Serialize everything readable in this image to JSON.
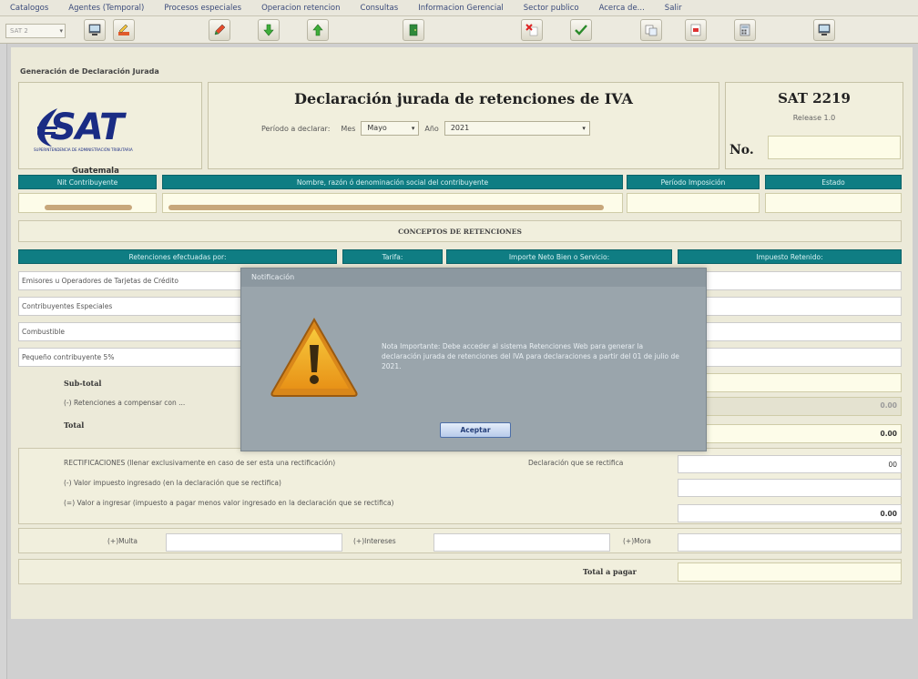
{
  "menu": [
    "Catalogos",
    "Agentes (Temporal)",
    "Procesos especiales",
    "Operacion retencion",
    "Consultas",
    "Informacion Gerencial",
    "Sector publico",
    "Acerca de...",
    "Salir"
  ],
  "toolbar": {
    "combo_value": "SAT 2",
    "icons": [
      "monitor-icon",
      "signature-icon",
      "pen-icon",
      "arrow-down-icon",
      "arrow-up-icon",
      "exit-door-icon",
      "cancel-x-icon",
      "check-icon",
      "copy-icon",
      "pdf-icon",
      "calculator-icon",
      "monitor-icon"
    ]
  },
  "section_title": "Generación de Declaración Jurada",
  "logo": {
    "text": "SAT",
    "subtitle": "SUPERINTENDENCIA DE ADMINISTRACIÓN TRIBUTARIA",
    "country": "Guatemala",
    "brand_color": "#1a2c84"
  },
  "declaration": {
    "title": "Declaración jurada de retenciones de IVA",
    "period_label": "Período a declarar:",
    "month_label": "Mes",
    "month_value": "Mayo",
    "year_label": "Año",
    "year_value": "2021"
  },
  "form_code": {
    "code": "SAT 2219",
    "release": "Release 1.0",
    "number_label": "No.",
    "number_value": ""
  },
  "taxpayer_headers": [
    "Nit Contribuyente",
    "Nombre, razón ó denominación social del contribuyente",
    "Período Imposición",
    "Estado"
  ],
  "concepts_title": "CONCEPTOS DE RETENCIONES",
  "retention_headers": [
    "Retenciones efectuadas por:",
    "Tarifa:",
    "Importe Neto Bien o Servicio:",
    "Impuesto Retenido:"
  ],
  "retention_rows": [
    "Emisores u Operadores de Tarjetas de Crédito",
    "Contribuyentes Especiales",
    "Combustible",
    "Pequeño contribuyente 5%"
  ],
  "subtotal_label": "Sub-total",
  "compensate_label": "(-) Retenciones a compensar con ...",
  "compensate_value": "0.00",
  "total_label": "Total",
  "total_value": "0.00",
  "rectifications": {
    "title": "RECTIFICACIONES (llenar exclusivamente en caso de ser esta una rectificación)",
    "declaration_label": "Declaración que se rectifica",
    "declaration_value": "00",
    "paid_label": "(-) Valor impuesto ingresado (en la declaración que se rectifica)",
    "to_pay_label": "(=) Valor a ingresar (impuesto a pagar menos valor ingresado en la declaración que se rectifica)",
    "to_pay_value": "0.00"
  },
  "penalties": {
    "fine_label": "(+)Multa",
    "interest_label": "(+)Intereses",
    "late_label": "(+)Mora"
  },
  "total_payable_label": "Total a pagar",
  "modal": {
    "title": "Notificación",
    "message": "Nota Importante: Debe acceder al sistema Retenciones Web para generar la declaración jurada de retenciones del IVA para declaraciones a partir del 01 de julio de 2021.",
    "button": "Aceptar",
    "icon": "warning-icon"
  },
  "colors": {
    "header_teal": "#0f7d83",
    "form_bg": "#ecead9",
    "input_bg": "#fdfce9",
    "modal_bg": "#9aa5ac"
  }
}
